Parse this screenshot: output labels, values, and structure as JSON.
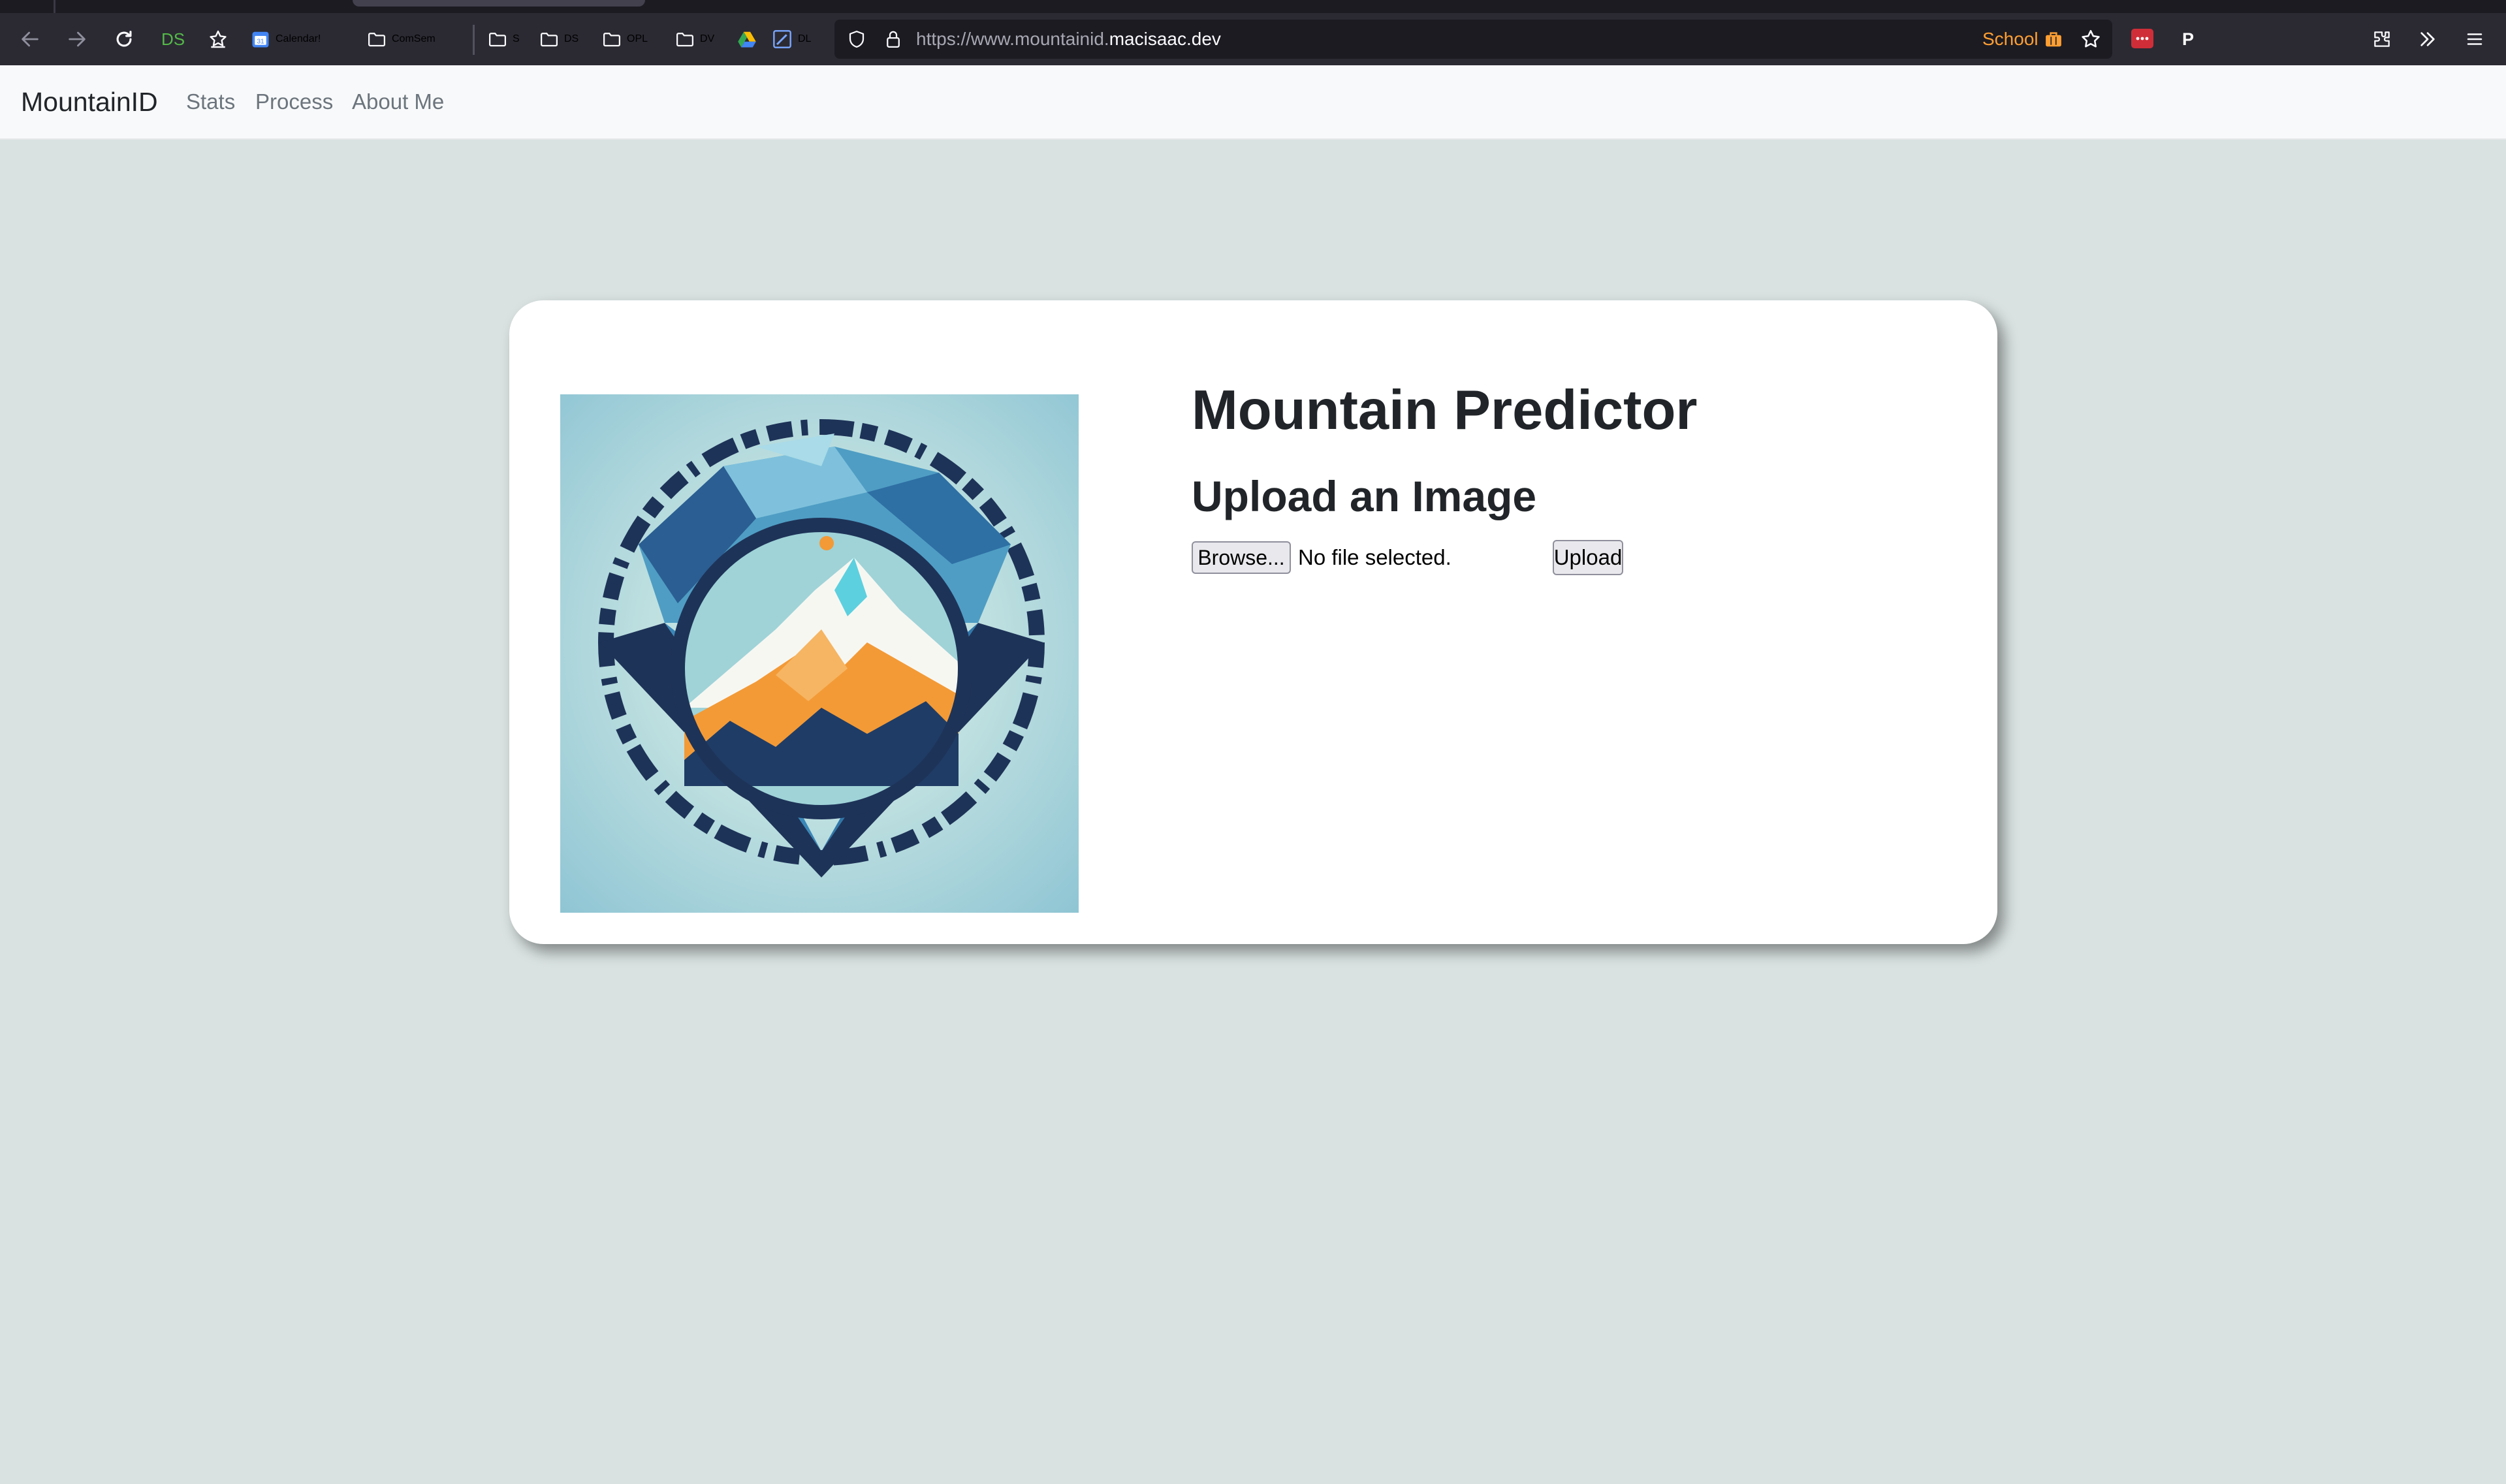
{
  "browser": {
    "bookmarks": [
      {
        "label": "DS",
        "icon": "ds-text-icon"
      },
      {
        "label": "",
        "icon": "bookmark-star-icon"
      },
      {
        "label": "Calendar!",
        "icon": "calendar-icon"
      },
      {
        "label": "ComSem",
        "icon": "folder-icon"
      },
      {
        "label": "S",
        "icon": "folder-icon"
      },
      {
        "label": "DS",
        "icon": "folder-icon"
      },
      {
        "label": "OPL",
        "icon": "folder-icon"
      },
      {
        "label": "DV",
        "icon": "folder-icon"
      },
      {
        "label": "",
        "icon": "google-drive-icon"
      },
      {
        "label": "DL",
        "icon": "edit-doc-icon"
      }
    ],
    "url_prefix": "https://www.mountainid.",
    "url_domain": "macisaac.dev",
    "container_label": "School",
    "extension_p_label": "P",
    "colors": {
      "toolbar_bg": "#2b2a33",
      "urlbar_bg": "#1c1b22",
      "container_accent": "#ff9f32",
      "ds_green": "#54b948"
    }
  },
  "navbar": {
    "brand": "MountainID",
    "links": [
      "Stats",
      "Process",
      "About Me"
    ]
  },
  "main": {
    "title": "Mountain Predictor",
    "subtitle": "Upload an Image",
    "browse_label": "Browse...",
    "file_status": "No file selected.",
    "upload_label": "Upload"
  },
  "theme": {
    "page_bg": "#d9e2e1",
    "card_bg": "#ffffff",
    "text": "#212529",
    "nav_link": "#6c757d"
  }
}
